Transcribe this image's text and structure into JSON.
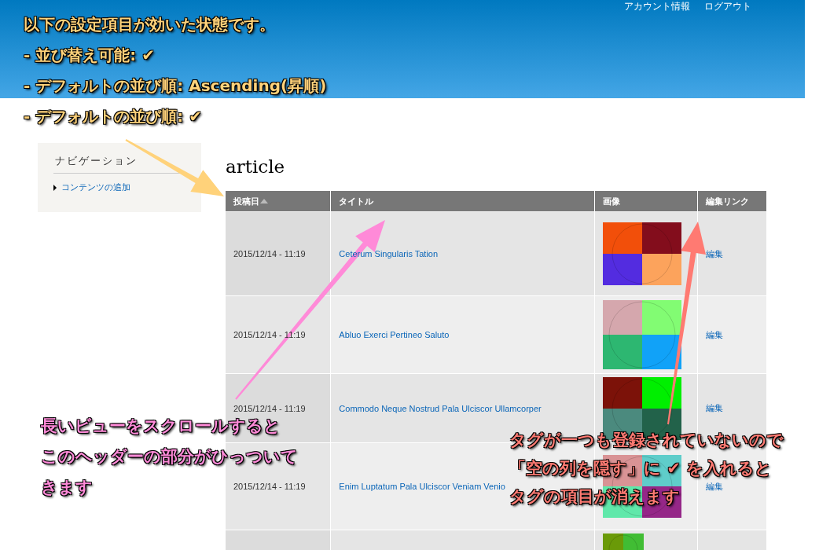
{
  "header": {
    "links": [
      "アカウント情報",
      "ログアウト"
    ]
  },
  "sidebar": {
    "title": "ナビゲーション",
    "items": [
      {
        "label": "コンテンツの追加"
      }
    ]
  },
  "page_title": "article",
  "table": {
    "columns": [
      {
        "label": "投稿日",
        "sorted": true
      },
      {
        "label": "タイトル",
        "sorted": false
      },
      {
        "label": "画像",
        "sorted": false
      },
      {
        "label": "編集リンク",
        "sorted": false
      }
    ],
    "rows": [
      {
        "date": "2015/12/14 - 11:19",
        "title": "Ceterum Singularis Tation",
        "image": {
          "kind": "picture"
        },
        "edit": "編集"
      },
      {
        "date": "2015/12/14 - 11:19",
        "title": "Abluo Exerci Pertineo Saluto",
        "image": {
          "kind": "picture"
        },
        "edit": "編集"
      },
      {
        "date": "2015/12/14 - 11:19",
        "title": "Commodo Neque Nostrud Pala Ulciscor Ullamcorper",
        "image": {
          "kind": "picture"
        },
        "edit": "編集"
      },
      {
        "date": "2015/12/14 - 11:19",
        "title": "Enim Luptatum Pala Ulciscor Veniam Venio",
        "image": {
          "kind": "picture"
        },
        "edit": "編集"
      },
      {
        "image": {
          "kind": "picture"
        }
      }
    ]
  },
  "annotations": [
    {
      "color": "#ffd27a",
      "lines": [
        "以下の設定項目が効いた状態です。",
        "- 並び替え可能: ✔",
        "- デフォルトの並び順: Ascending(昇順)",
        "- デフォルトの並び順: ✔"
      ]
    },
    {
      "color": "#ff8ad8",
      "lines": [
        "長いビューをスクロールすると",
        "このヘッダーの部分がひっついて",
        "きます"
      ]
    },
    {
      "color": "#ff7a72",
      "lines": [
        "タグが一つも登録されていないので",
        "「空の列を隠す」に ✔ を入れると",
        "タグの項目が消えます"
      ]
    }
  ]
}
